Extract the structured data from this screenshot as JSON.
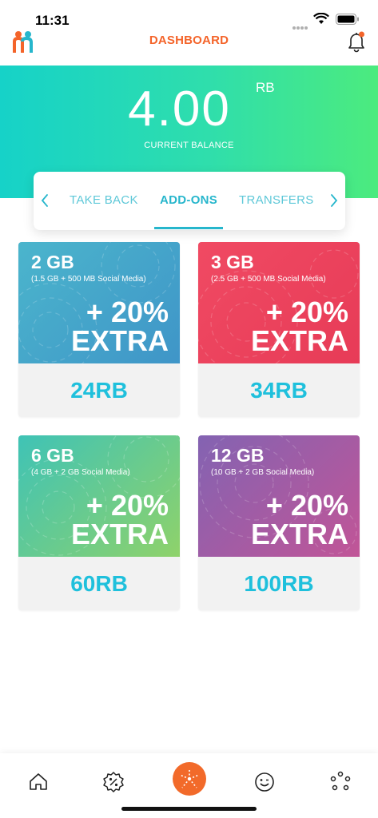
{
  "status_bar": {
    "time": "11:31"
  },
  "header": {
    "title": "DASHBOARD"
  },
  "balance": {
    "amount": "4.00",
    "unit": "RB",
    "label": "CURRENT BALANCE"
  },
  "tabs": {
    "items": [
      {
        "label": "TAKE BACK",
        "active": false
      },
      {
        "label": "ADD-ONS",
        "active": true
      },
      {
        "label": "TRANSFERS",
        "active": false
      }
    ]
  },
  "cards": [
    {
      "data": "2 GB",
      "detail": "(1.5 GB + 500 MB Social Media)",
      "bonus": "+ 20%",
      "bonus_word": "EXTRA",
      "price": "24RB",
      "color": "#4ba7cb"
    },
    {
      "data": "3 GB",
      "detail": "(2.5 GB + 500 MB Social Media)",
      "bonus": "+ 20%",
      "bonus_word": "EXTRA",
      "price": "34RB",
      "color": "#ec435e"
    },
    {
      "data": "6 GB",
      "detail": "(4 GB + 2 GB Social Media)",
      "bonus": "+ 20%",
      "bonus_word": "EXTRA",
      "price": "60RB",
      "color": "#66ca91"
    },
    {
      "data": "12 GB",
      "detail": "(10 GB + 2 GB Social Media)",
      "bonus": "+ 20%",
      "bonus_word": "EXTRA",
      "price": "100RB",
      "color": "#a15ba4"
    }
  ],
  "bottom_nav": {
    "items": [
      {
        "icon": "home-icon"
      },
      {
        "icon": "percent-badge-icon"
      },
      {
        "icon": "starburst-center-icon"
      },
      {
        "icon": "smiley-icon"
      },
      {
        "icon": "dots-circle-icon"
      }
    ]
  },
  "colors": {
    "accent": "#f4642a",
    "teal": "#26b6cc",
    "price": "#1fc0dc"
  }
}
